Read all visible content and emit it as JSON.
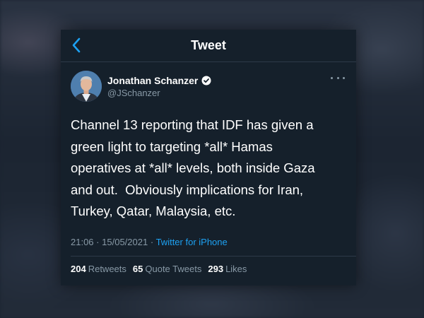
{
  "header": {
    "title": "Tweet",
    "back_icon": "chevron-left-icon",
    "accent_color": "#1da1f2"
  },
  "author": {
    "name": "Jonathan Schanzer",
    "handle": "@JSchanzer",
    "verified": true,
    "verified_icon": "verified-badge-icon",
    "more_icon": "more-horizontal-icon"
  },
  "tweet": {
    "lines": [
      "Channel 13 reporting that IDF has given a",
      "green light to targeting *all* Hamas",
      "operatives at *all* levels, both inside Gaza",
      "and out.  Obviously implications for Iran,",
      "Turkey, Qatar, Malaysia, etc."
    ],
    "time": "21:06",
    "date": "15/05/2021",
    "separator": "·",
    "source": "Twitter for iPhone"
  },
  "stats": {
    "retweets": {
      "count": "204",
      "label": "Retweets"
    },
    "quotes": {
      "count": "65",
      "label": "Quote Tweets"
    },
    "likes": {
      "count": "293",
      "label": "Likes"
    }
  },
  "colors": {
    "card_background": "#15202b",
    "text_primary": "#ffffff",
    "text_secondary": "#8899a6",
    "link": "#1da1f2"
  }
}
